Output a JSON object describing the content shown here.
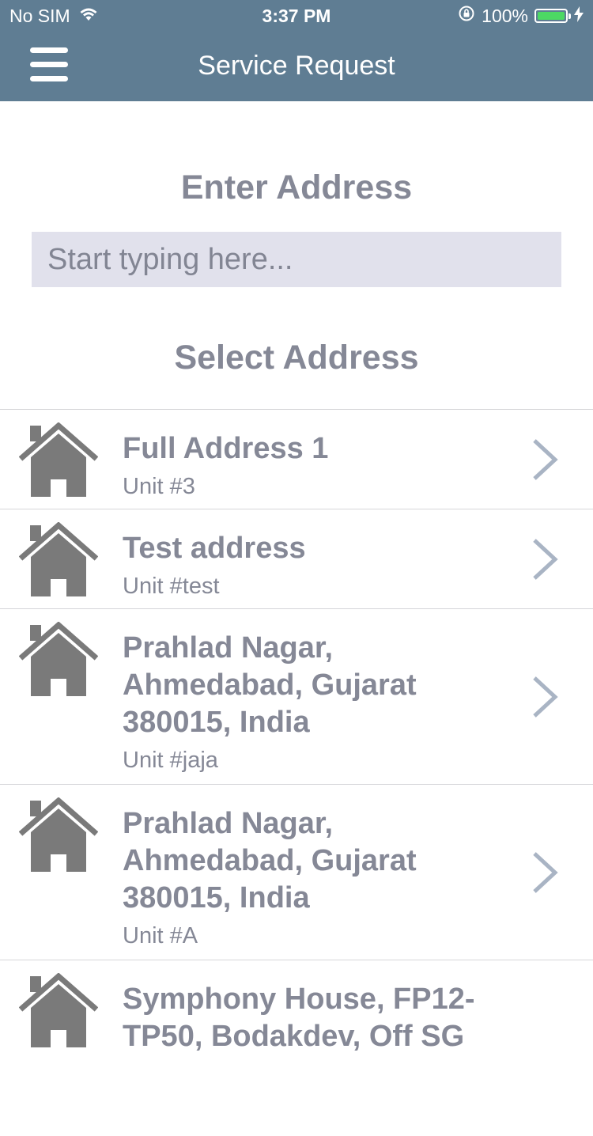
{
  "status_bar": {
    "carrier": "No SIM",
    "time": "3:37 PM",
    "battery_percent": "100%",
    "battery_level": 1.0
  },
  "nav": {
    "title": "Service Request",
    "menu_icon": "hamburger-menu-icon"
  },
  "enter_address": {
    "heading": "Enter Address",
    "input_value": "",
    "placeholder": "Start typing here..."
  },
  "select_address": {
    "heading": "Select Address",
    "items": [
      {
        "title": "Full Address 1",
        "unit": "Unit #3",
        "icon": "house-icon"
      },
      {
        "title": "Test address",
        "unit": "Unit #test",
        "icon": "house-icon"
      },
      {
        "title": "Prahlad Nagar, Ahmedabad, Gujarat 380015, India",
        "unit": "Unit #jaja",
        "icon": "house-icon"
      },
      {
        "title": "Prahlad Nagar, Ahmedabad, Gujarat 380015, India",
        "unit": "Unit #A",
        "icon": "house-icon"
      },
      {
        "title": "Symphony House, FP12-TP50, Bodakdev, Off SG",
        "unit": "",
        "icon": "house-icon"
      }
    ]
  },
  "colors": {
    "header": "#5f7d93",
    "text_gray": "#858896",
    "input_bg": "#e1e1ec",
    "chevron": "#a9b4c4",
    "house_icon": "#7a7a7a",
    "battery": "#4cd964"
  }
}
